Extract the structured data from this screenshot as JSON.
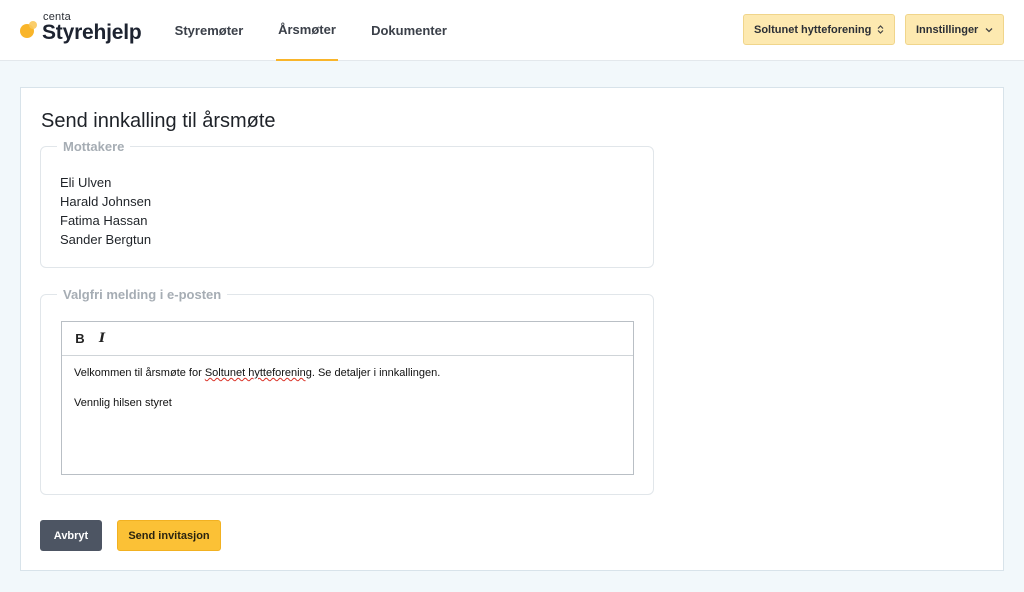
{
  "brand": {
    "small": "centa",
    "name": "Styrehjelp"
  },
  "nav": {
    "items": [
      {
        "label": "Styremøter",
        "active": false
      },
      {
        "label": "Årsmøter",
        "active": true
      },
      {
        "label": "Dokumenter",
        "active": false
      }
    ]
  },
  "header": {
    "org_selector": {
      "label": "Soltunet hytteforening",
      "icon": "chevron-up-down-icon"
    },
    "settings": {
      "label": "Innstillinger",
      "icon": "chevron-down-icon"
    }
  },
  "page": {
    "title": "Send innkalling til årsmøte"
  },
  "recipients": {
    "legend": "Mottakere",
    "names": [
      "Eli Ulven",
      "Harald Johnsen",
      "Fatima Hassan",
      "Sander Bergtun"
    ]
  },
  "message": {
    "legend": "Valgfri melding i e-posten",
    "toolbar": {
      "bold": "B",
      "italic": "I"
    },
    "line1_before": "Velkommen til årsmøte for ",
    "line1_misspelled": "Soltunet hytteforening",
    "line1_after": ". Se detaljer i innkallingen.",
    "line2": "Vennlig hilsen styret"
  },
  "actions": {
    "cancel": "Avbryt",
    "send": "Send invitasjon"
  },
  "colors": {
    "accent": "#f9b52a",
    "button_dark": "#4d5563",
    "button_primary": "#fbc136",
    "page_bg": "#f2f8fb"
  }
}
